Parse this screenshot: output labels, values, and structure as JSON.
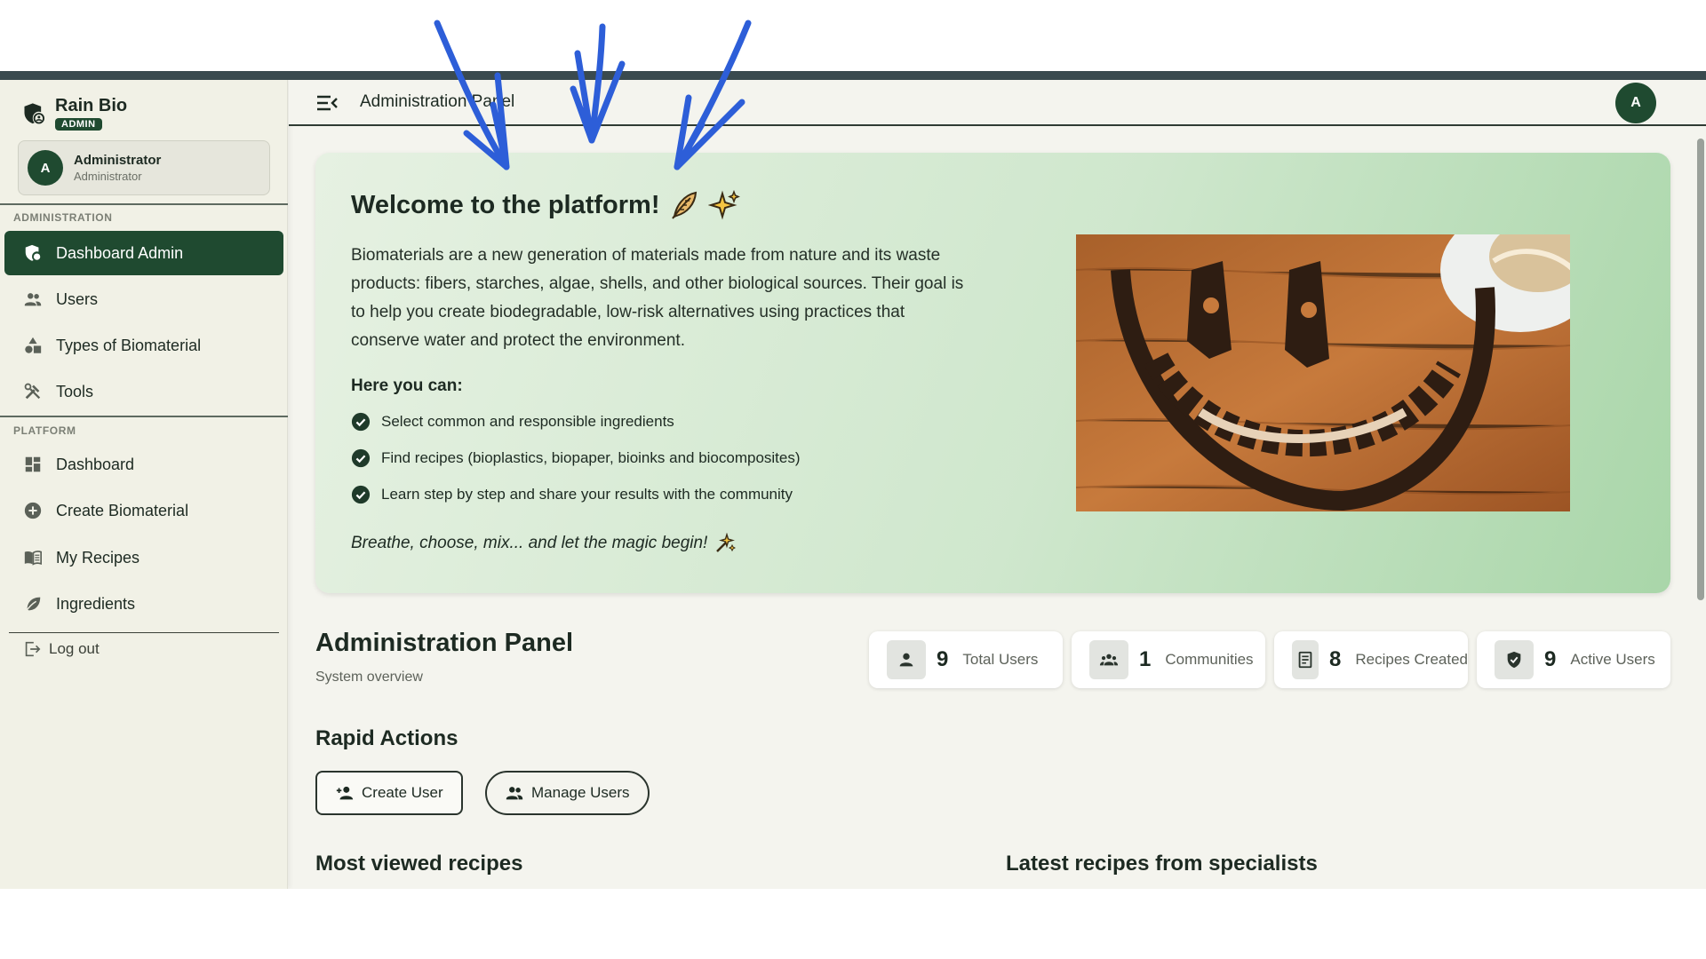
{
  "brand": {
    "name": "Rain Bio",
    "badge": "ADMIN"
  },
  "user": {
    "initial": "A",
    "name": "Administrator",
    "role": "Administrator"
  },
  "sidebar": {
    "sections": [
      {
        "label": "ADMINISTRATION"
      },
      {
        "label": "PLATFORM"
      }
    ],
    "items": [
      {
        "label": "Dashboard Admin",
        "icon": "shield-person-icon",
        "active": true
      },
      {
        "label": "Users",
        "icon": "users-icon"
      },
      {
        "label": "Types of Biomaterial",
        "icon": "shapes-icon"
      },
      {
        "label": "Tools",
        "icon": "tools-icon"
      },
      {
        "label": "Dashboard",
        "icon": "dashboard-icon"
      },
      {
        "label": "Create Biomaterial",
        "icon": "add-circle-icon"
      },
      {
        "label": "My Recipes",
        "icon": "book-icon"
      },
      {
        "label": "Ingredients",
        "icon": "leaf-icon"
      }
    ],
    "logout": "Log out"
  },
  "header": {
    "title": "Administration Panel",
    "avatar": "A"
  },
  "hero": {
    "title": "Welcome to the platform!",
    "description": "Biomaterials are a new generation of materials made from nature and its waste products: fibers, starches, algae, shells, and other biological sources. Their goal is to help you create biodegradable, low-risk alternatives using practices that conserve water and protect the environment.",
    "subtitle": "Here you can:",
    "list": [
      "Select common and responsible ingredients",
      "Find recipes (bioplastics, biopaper, bioinks and biocomposites)",
      "Learn step by step and share your results with the community"
    ],
    "quote": "Breathe, choose, mix... and let the magic begin!"
  },
  "panel": {
    "title": "Administration Panel",
    "subtitle": "System overview"
  },
  "stats": [
    {
      "value": "9",
      "label": "Total Users",
      "icon": "person-icon"
    },
    {
      "value": "1",
      "label": "Communities",
      "icon": "group-icon"
    },
    {
      "value": "8",
      "label": "Recipes Created",
      "icon": "receipt-icon"
    },
    {
      "value": "9",
      "label": "Active Users",
      "icon": "verified-shield-icon"
    }
  ],
  "rapid_actions": {
    "title": "Rapid Actions",
    "create_user": "Create User",
    "manage_users": "Manage Users"
  },
  "sections": {
    "most_viewed": "Most viewed recipes",
    "latest": "Latest recipes from specialists"
  },
  "colors": {
    "primary": "#1f4a30",
    "annotation": "#2d5ed8"
  }
}
